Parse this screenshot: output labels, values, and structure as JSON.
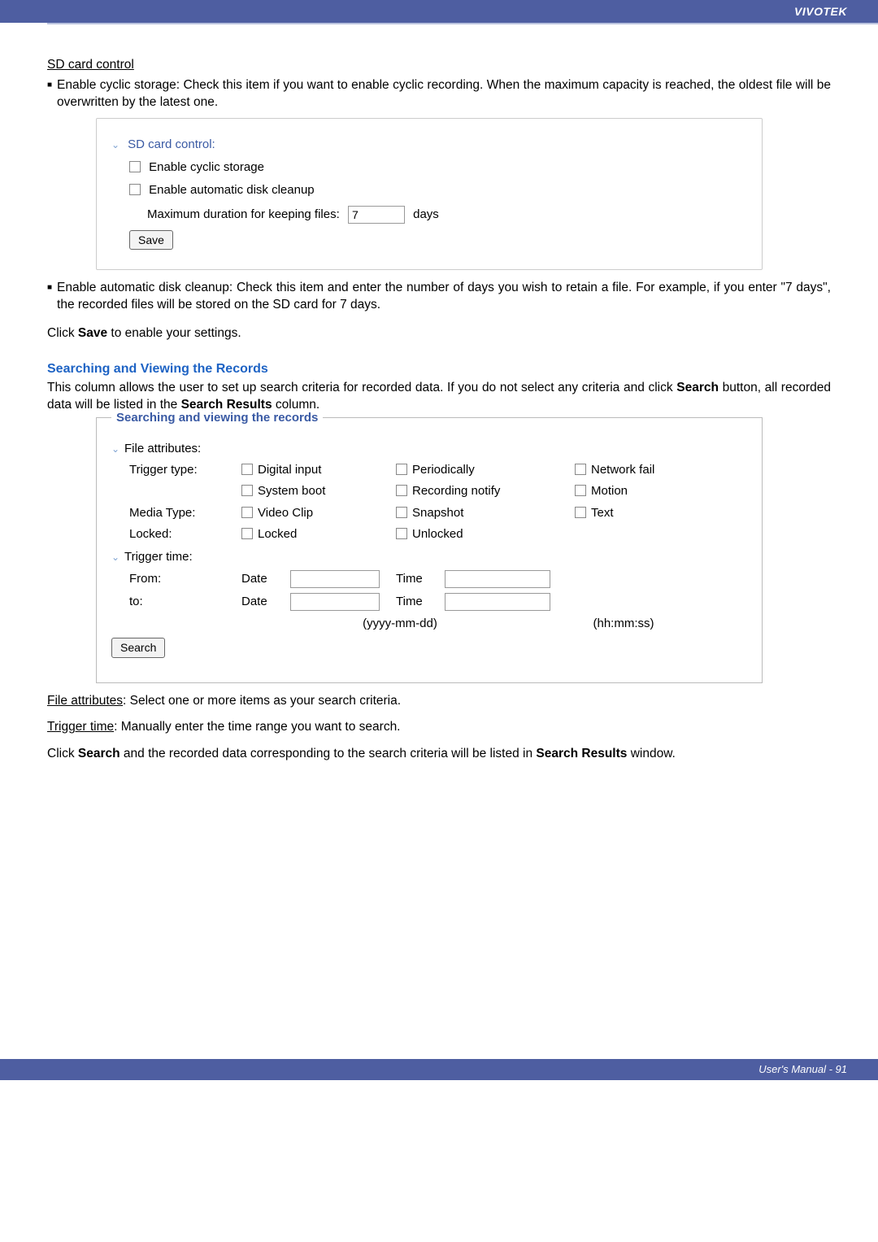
{
  "brand": "VIVOTEK",
  "sd": {
    "heading": "SD card control",
    "bullet1": "Enable cyclic storage: Check this item if you want to enable cyclic recording. When the maximum capacity is reached, the oldest file will be overwritten by the latest one.",
    "panel_title": "SD card control:",
    "cb_cyclic": "Enable cyclic storage",
    "cb_cleanup": "Enable automatic disk cleanup",
    "max_label": "Maximum duration for keeping files:",
    "max_value": "7",
    "max_unit": "days",
    "save_btn": "Save",
    "bullet2": "Enable automatic disk cleanup: Check this item and enter the number of days you wish to retain a file. For example, if you enter \"7 days\", the recorded files will be stored on the SD card for 7 days.",
    "click_save_pre": "Click ",
    "click_save_b": "Save",
    "click_save_post": " to enable your settings."
  },
  "search": {
    "heading": "Searching and Viewing the Records",
    "intro_pre": "This column allows the user to set up search criteria for recorded data. If you do not select any criteria and click ",
    "intro_b1": "Search",
    "intro_mid": " button, all recorded data will be listed in the ",
    "intro_b2": "Search Results",
    "intro_post": " column.",
    "legend": "Searching and viewing the records",
    "file_attr": "File attributes:",
    "trigger_type": "Trigger type:",
    "digital": "Digital input",
    "periodically": "Periodically",
    "network_fail": "Network fail",
    "system_boot": "System boot",
    "recording_notify": "Recording notify",
    "motion": "Motion",
    "media_type": "Media Type:",
    "video_clip": "Video Clip",
    "snapshot": "Snapshot",
    "text": "Text",
    "locked_label": "Locked:",
    "locked": "Locked",
    "unlocked": "Unlocked",
    "trigger_time": "Trigger time:",
    "from": "From:",
    "to": "to:",
    "date": "Date",
    "time": "Time",
    "date_hint": "(yyyy-mm-dd)",
    "time_hint": "(hh:mm:ss)",
    "search_btn": "Search"
  },
  "after": {
    "file_attr_u": "File attributes",
    "file_attr_rest": ": Select one or more items as your search criteria.",
    "trigger_u": "Trigger time",
    "trigger_rest": ": Manually enter the time range you want to search.",
    "last_pre": "Click ",
    "last_b1": "Search",
    "last_mid": " and the recorded data corresponding to the search criteria will be listed in ",
    "last_b2": "Search Results",
    "last_post": " window."
  },
  "footer": "User's Manual - 91"
}
